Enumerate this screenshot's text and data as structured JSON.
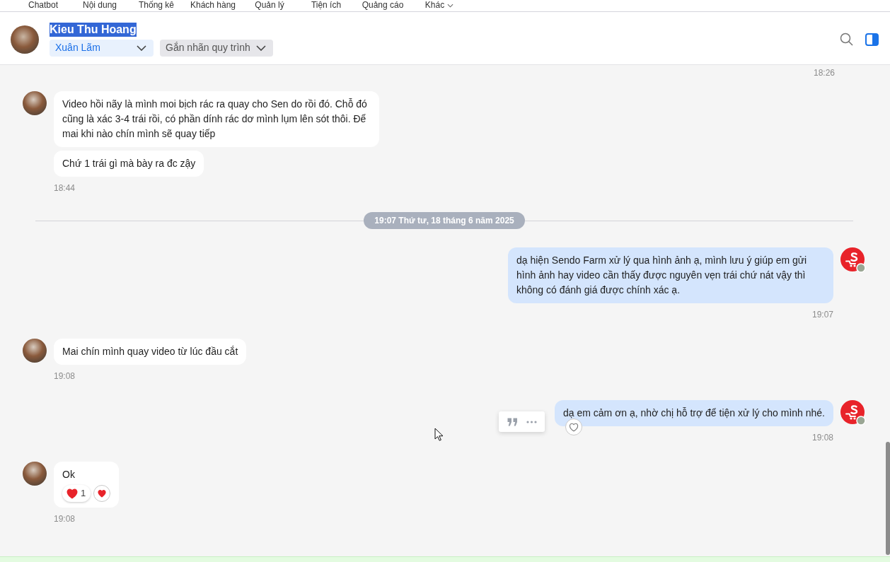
{
  "top_nav": [
    {
      "label": "Chatbot",
      "dropdown": false
    },
    {
      "label": "Nội dung",
      "dropdown": false
    },
    {
      "label": "Thống kê",
      "dropdown": false
    },
    {
      "label": "Khách hàng",
      "dropdown": false
    },
    {
      "label": "Quản lý",
      "dropdown": false
    },
    {
      "label": "Tiện ích",
      "dropdown": false
    },
    {
      "label": "Quảng cáo",
      "dropdown": false
    },
    {
      "label": "Khác",
      "dropdown": true
    }
  ],
  "header": {
    "contact_name": "Kieu Thu Hoang",
    "name_highlighted": true,
    "assignee": "Xuân Lãm",
    "tag_select": "Gắn nhãn quy trình"
  },
  "messages": [
    {
      "kind": "outgoing_time",
      "time": "18:26"
    },
    {
      "kind": "incoming",
      "bubbles": [
        {
          "text": "Video hồi nãy là mình moi bịch rác ra quay cho Sen do rồi đó. Chỗ đó cũng là xác 3-4 trái rồi, có phần dính rác dơ mình lụm lên sót thôi. Để mai khi nào chín mình sẽ quay tiếp",
          "hovered": false,
          "reacted": false
        },
        {
          "text": "Chứ 1 trái gì mà bày ra đc zậy",
          "hovered": false,
          "reacted": false
        }
      ],
      "time": "18:44"
    },
    {
      "kind": "divider",
      "label": "19:07 Thứ tư, 18 tháng 6 năm 2025"
    },
    {
      "kind": "outgoing",
      "bubbles": [
        {
          "text": "dạ hiện Sendo Farm xử lý qua hình ảnh ạ, mình lưu ý giúp em gửi hình ảnh hay video cần thấy được nguyên vẹn trái chứ nát vậy thì không có đánh giá được chính xác ạ.",
          "hovered": false,
          "reacted": false
        }
      ],
      "time": "19:07"
    },
    {
      "kind": "incoming",
      "bubbles": [
        {
          "text": "Mai chín mình quay video từ lúc đầu cắt",
          "hovered": false,
          "reacted": false
        }
      ],
      "time": "19:08"
    },
    {
      "kind": "outgoing",
      "bubbles": [
        {
          "text": "dạ em cảm ơn ạ, nhờ chị hỗ trợ để tiện xử lý cho mình nhé.",
          "hovered": true,
          "reacted": false
        }
      ],
      "time": "19:08"
    },
    {
      "kind": "incoming",
      "bubbles": [
        {
          "text": "Ok",
          "hovered": false,
          "reacted": true,
          "reactions": [
            {
              "count": "1"
            }
          ]
        }
      ],
      "time": "19:08"
    }
  ]
}
